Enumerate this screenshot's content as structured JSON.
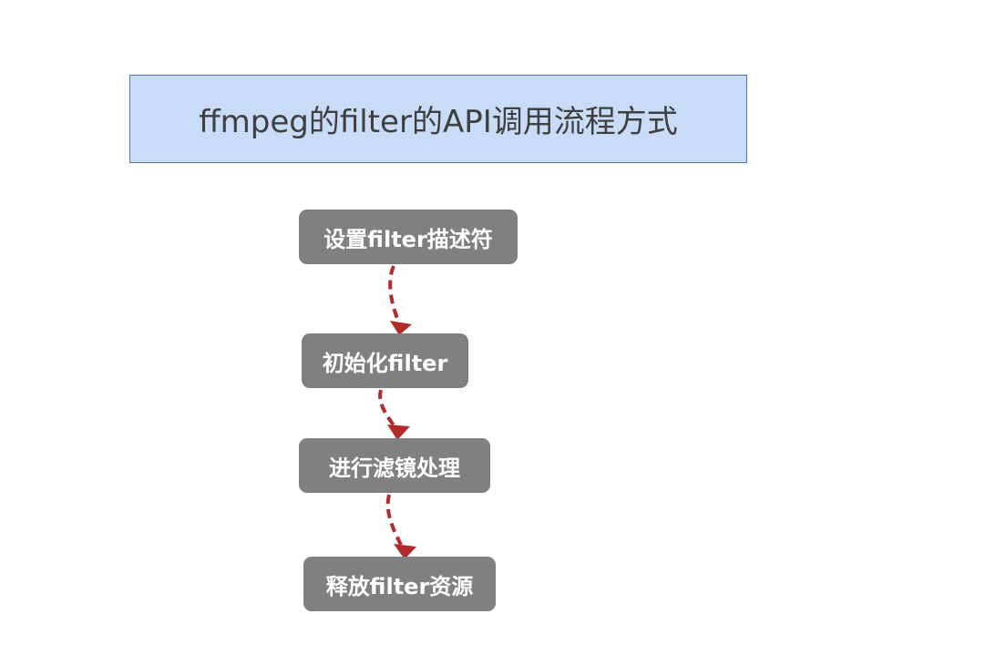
{
  "diagram": {
    "title": "ffmpeg的filter的API调用流程方式",
    "steps": [
      {
        "label": "设置filter描述符"
      },
      {
        "label": "初始化filter"
      },
      {
        "label": "进行滤镜处理"
      },
      {
        "label": "释放filter资源"
      }
    ],
    "colors": {
      "title_fill": "#c9dcf7",
      "title_border": "#5b79b0",
      "step_fill": "#808080",
      "arrow": "#b22a2a"
    }
  }
}
